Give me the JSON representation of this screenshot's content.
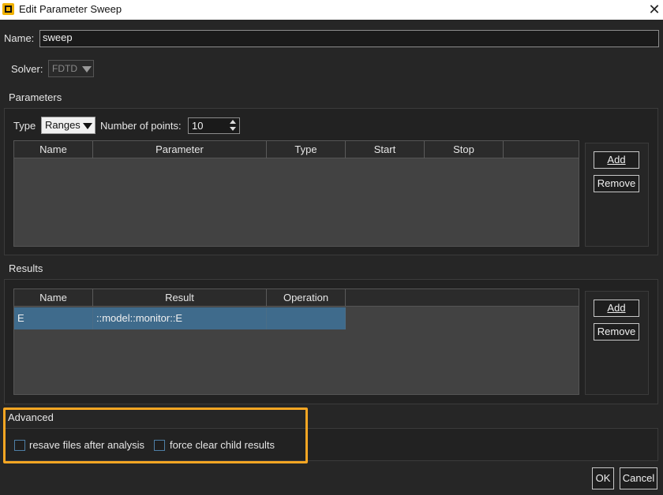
{
  "window": {
    "title": "Edit Parameter Sweep",
    "close_symbol": "✕"
  },
  "name": {
    "label": "Name:",
    "value": "sweep"
  },
  "solver": {
    "label": "Solver:",
    "value": "FDTD"
  },
  "parameters": {
    "group_label": "Parameters",
    "type_label": "Type",
    "type_value": "Ranges",
    "points_label": "Number of points:",
    "points_value": "10",
    "columns": [
      "Name",
      "Parameter",
      "Type",
      "Start",
      "Stop"
    ],
    "add_label": "Add",
    "remove_label": "Remove"
  },
  "results": {
    "group_label": "Results",
    "columns": [
      "Name",
      "Result",
      "Operation"
    ],
    "rows": [
      {
        "name": "E",
        "result": "::model::monitor::E",
        "operation": ""
      }
    ],
    "add_label": "Add",
    "remove_label": "Remove"
  },
  "advanced": {
    "group_label": "Advanced",
    "resave_label": "resave files after analysis",
    "resave_checked": false,
    "force_clear_label": "force clear child results",
    "force_clear_checked": false
  },
  "footer": {
    "ok_label": "OK",
    "cancel_label": "Cancel"
  },
  "colors": {
    "highlight": "#f5a623",
    "selection": "#3f6b8c",
    "accent": "#f0b100"
  }
}
